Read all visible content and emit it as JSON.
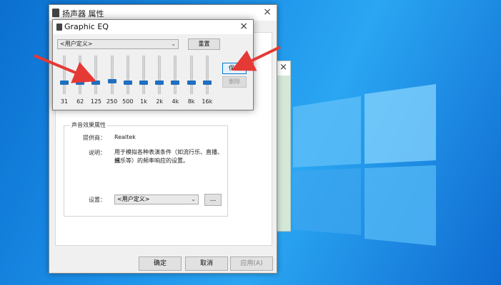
{
  "desktop": {
    "accent": "#1b8fe8"
  },
  "props_window": {
    "title": "扬声器 属性",
    "close": "×",
    "group_title": "声音效果属性",
    "provider_label": "提供商：",
    "provider_value": "Realtek",
    "desc_label": "说明：",
    "desc_line1": "用于模拟各种表演条件（如流行乐、直播、摇",
    "desc_line2": "滚乐等）的频率响应的设置。",
    "setting_label": "设置：",
    "setting_value": "<用户定义>",
    "dots_label": "...",
    "ok_label": "确定",
    "cancel_label": "取消",
    "apply_label": "应用(A)"
  },
  "back_window": {
    "close": "×"
  },
  "eq_dialog": {
    "title": "Graphic EQ",
    "close": "×",
    "preset_value": "<用户定义>",
    "reset_label": "重置",
    "save_label": "保存",
    "delete_label": "删除",
    "bands": [
      {
        "freq": "31",
        "level": 0.3
      },
      {
        "freq": "62",
        "level": 0.3
      },
      {
        "freq": "125",
        "level": 0.3
      },
      {
        "freq": "250",
        "level": 0.36
      },
      {
        "freq": "500",
        "level": 0.3
      },
      {
        "freq": "1k",
        "level": 0.3
      },
      {
        "freq": "2k",
        "level": 0.3
      },
      {
        "freq": "4k",
        "level": 0.3
      },
      {
        "freq": "8k",
        "level": 0.3
      },
      {
        "freq": "16k",
        "level": 0.3
      }
    ]
  }
}
